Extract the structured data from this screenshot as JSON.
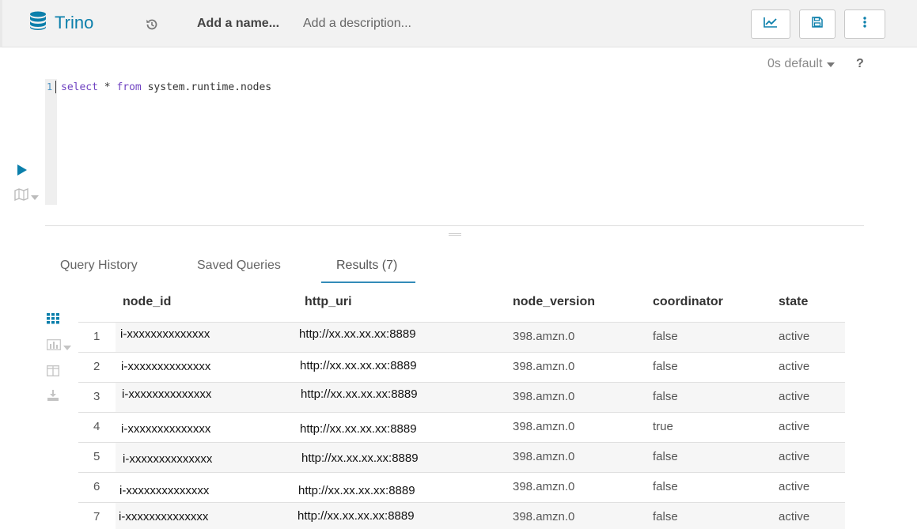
{
  "header": {
    "app_name": "Trino",
    "name_placeholder": "Add a name...",
    "description_placeholder": "Add a description..."
  },
  "editor": {
    "execution_info": "0s default",
    "help": "?",
    "line_number": "1",
    "query_keyword_select": "select",
    "query_star": " * ",
    "query_keyword_from": "from",
    "query_rest": " system.runtime.nodes"
  },
  "tabs": [
    {
      "label": "Query History"
    },
    {
      "label": "Saved Queries"
    },
    {
      "label": "Results (7)"
    }
  ],
  "results": {
    "columns": [
      "node_id",
      "http_uri",
      "node_version",
      "coordinator",
      "state"
    ],
    "rows": [
      {
        "num": "1",
        "node_id": "i-xxxxxxxxxxxxxx",
        "http_uri": "http://xx.xx.xx.xx:8889",
        "node_version": "398.amzn.0",
        "coordinator": "false",
        "state": "active"
      },
      {
        "num": "2",
        "node_id": "i-xxxxxxxxxxxxxx",
        "http_uri": "http://xx.xx.xx.xx:8889",
        "node_version": "398.amzn.0",
        "coordinator": "false",
        "state": "active"
      },
      {
        "num": "3",
        "node_id": "i-xxxxxxxxxxxxxx",
        "http_uri": "http://xx.xx.xx.xx:8889",
        "node_version": "398.amzn.0",
        "coordinator": "false",
        "state": "active"
      },
      {
        "num": "4",
        "node_id": "i-xxxxxxxxxxxxxx",
        "http_uri": "http://xx.xx.xx.xx:8889",
        "node_version": "398.amzn.0",
        "coordinator": "true",
        "state": "active"
      },
      {
        "num": "5",
        "node_id": "i-xxxxxxxxxxxxxx",
        "http_uri": "http://xx.xx.xx.xx:8889",
        "node_version": "398.amzn.0",
        "coordinator": "false",
        "state": "active"
      },
      {
        "num": "6",
        "node_id": "i-xxxxxxxxxxxxxx",
        "http_uri": "http://xx.xx.xx.xx:8889",
        "node_version": "398.amzn.0",
        "coordinator": "false",
        "state": "active"
      },
      {
        "num": "7",
        "node_id": "i-xxxxxxxxxxxxxx",
        "http_uri": "http://xx.xx.xx.xx:8889",
        "node_version": "398.amzn.0",
        "coordinator": "false",
        "state": "active"
      }
    ]
  },
  "icons": {
    "database": "database-icon",
    "history": "history-icon",
    "chart": "line-chart-icon",
    "save": "save-icon",
    "more": "more-vertical-icon",
    "run": "play-icon",
    "map": "map-icon",
    "grid": "grid-icon",
    "bar_chart": "bar-chart-icon",
    "columns": "columns-icon",
    "download": "download-icon"
  },
  "colors": {
    "accent": "#0b7fab",
    "tab_underline": "#338bb8",
    "topbar_bg": "#f2f2f2"
  }
}
